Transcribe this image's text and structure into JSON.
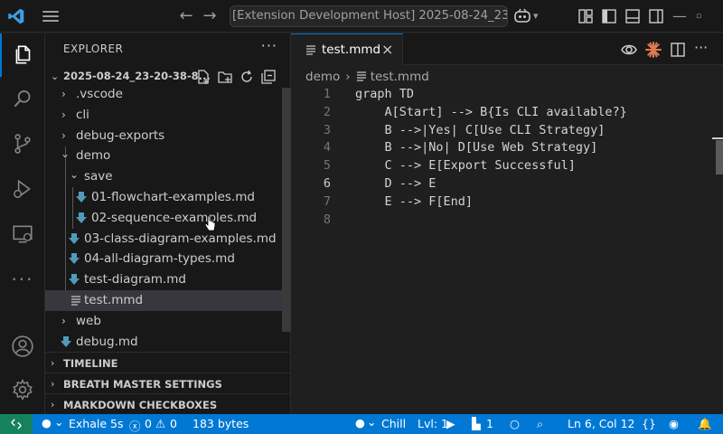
{
  "window": {
    "title": "[Extension Development Host] 2025-08-24_23-20-38-82"
  },
  "sidebar": {
    "title": "EXPLORER",
    "more": "···",
    "root": "2025-08-24_23-20-38-8...",
    "tree": [
      {
        "label": ".vscode",
        "kind": "folder",
        "open": false
      },
      {
        "label": "cli",
        "kind": "folder",
        "open": false
      },
      {
        "label": "debug-exports",
        "kind": "folder",
        "open": false
      },
      {
        "label": "demo",
        "kind": "folder",
        "open": true
      },
      {
        "label": "save",
        "kind": "folder",
        "open": true
      },
      {
        "label": "01-flowchart-examples.md",
        "kind": "md"
      },
      {
        "label": "02-sequence-examples.md",
        "kind": "md"
      },
      {
        "label": "03-class-diagram-examples.md",
        "kind": "md"
      },
      {
        "label": "04-all-diagram-types.md",
        "kind": "md"
      },
      {
        "label": "test-diagram.md",
        "kind": "md"
      },
      {
        "label": "test.mmd",
        "kind": "mmd",
        "selected": true
      },
      {
        "label": "web",
        "kind": "folder",
        "open": false
      },
      {
        "label": "debug.md",
        "kind": "md"
      }
    ],
    "sections": [
      "TIMELINE",
      "BREATH MASTER SETTINGS",
      "MARKDOWN CHECKBOXES"
    ]
  },
  "editor": {
    "tab_label": "test.mmd",
    "close_glyph": "×",
    "breadcrumb_folder": "demo",
    "breadcrumb_sep": "›",
    "breadcrumb_file": "test.mmd",
    "current_line": 6,
    "lines": [
      {
        "n": "1",
        "text": "graph TD"
      },
      {
        "n": "2",
        "text": "    A[Start] --> B{Is CLI available?}"
      },
      {
        "n": "3",
        "text": "    B -->|Yes| C[Use CLI Strategy]"
      },
      {
        "n": "4",
        "text": "    B -->|No| D[Use Web Strategy]"
      },
      {
        "n": "5",
        "text": "    C --> E[Export Successful]"
      },
      {
        "n": "6",
        "text": "    D --> E"
      },
      {
        "n": "7",
        "text": "    E --> F[End]"
      },
      {
        "n": "8",
        "text": ""
      }
    ]
  },
  "statusbar": {
    "breath": "Exhale 5s",
    "errors": "0",
    "warnings": "0",
    "size": "183 bytes",
    "mood": "Chill",
    "level": "Lvl: 1",
    "sessions": "1",
    "position": "Ln 6, Col 12",
    "language": "{}"
  },
  "colors": {
    "accent": "#0078d4",
    "remote": "#16825d",
    "md_icon": "#519aba"
  }
}
